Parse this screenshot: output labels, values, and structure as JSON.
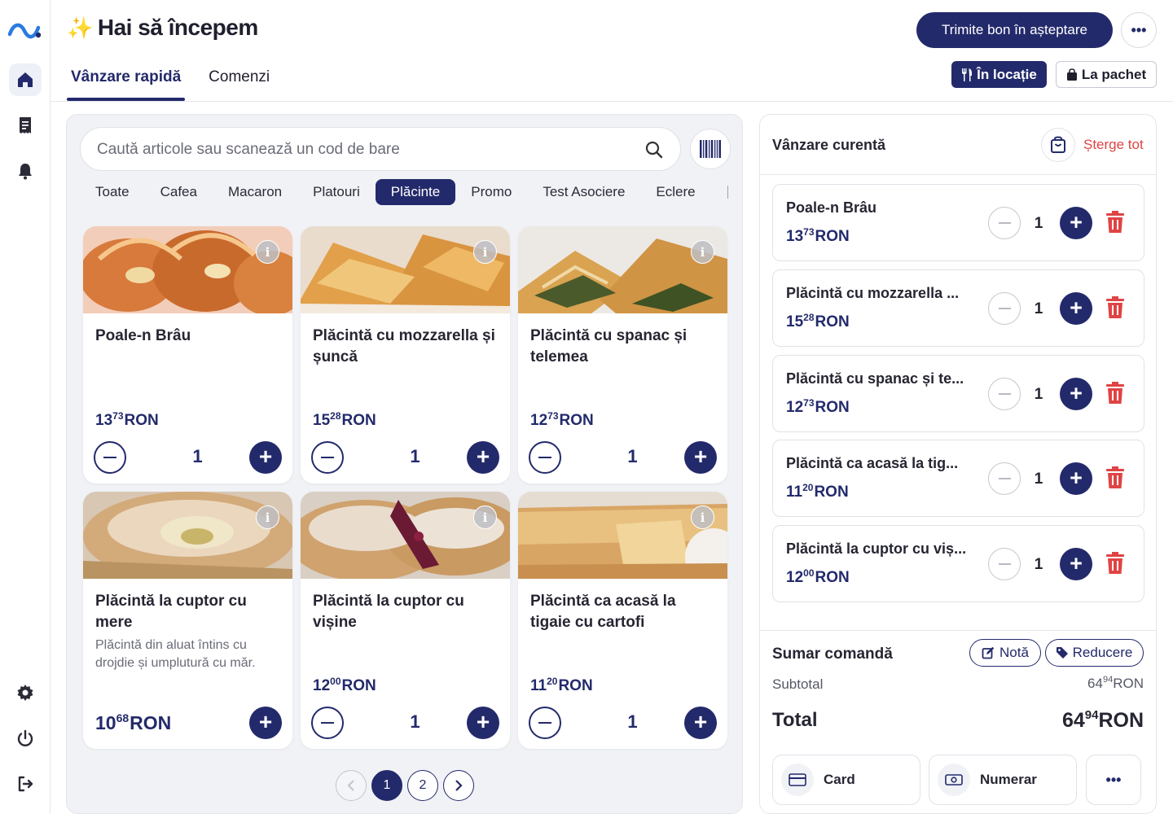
{
  "header": {
    "title": "Hai să începem",
    "tabs": [
      {
        "label": "Vânzare rapidă",
        "active": true
      },
      {
        "label": "Comenzi",
        "active": false
      }
    ],
    "send_button": "Trimite bon în așteptare",
    "more_button": "•••",
    "modes": {
      "dine_in": "În locație",
      "takeaway": "La pachet"
    }
  },
  "sidebar": {
    "items": [
      {
        "icon": "home-icon",
        "active": true
      },
      {
        "icon": "receipt-icon",
        "active": false
      },
      {
        "icon": "bell-icon",
        "active": false
      },
      {
        "icon": "gear-icon",
        "active": false
      },
      {
        "icon": "power-icon",
        "active": false
      },
      {
        "icon": "logout-icon",
        "active": false
      }
    ]
  },
  "catalog": {
    "search_placeholder": "Caută articole sau scanează un cod de bare",
    "categories": [
      "Toate",
      "Cafea",
      "Macaron",
      "Platouri",
      "Plăcinte",
      "Promo",
      "Test Asociere",
      "Eclere"
    ],
    "active_category": "Plăcinte",
    "products": [
      {
        "name": "Poale-n Brâu",
        "desc": "",
        "price_int": "13",
        "price_dec": "73",
        "currency": "RON",
        "qty": "1"
      },
      {
        "name": "Plăcintă cu mozzarella și șuncă",
        "desc": "",
        "price_int": "15",
        "price_dec": "28",
        "currency": "RON",
        "qty": "1"
      },
      {
        "name": "Plăcintă cu spanac și telemea",
        "desc": "",
        "price_int": "12",
        "price_dec": "73",
        "currency": "RON",
        "qty": "1"
      },
      {
        "name": "Plăcintă la cuptor cu mere",
        "desc": "Plăcintă din aluat întins cu drojdie și umplutură cu măr.",
        "price_int": "10",
        "price_dec": "68",
        "currency": "RON",
        "qty": ""
      },
      {
        "name": "Plăcintă la cuptor cu vișine",
        "desc": "",
        "price_int": "12",
        "price_dec": "00",
        "currency": "RON",
        "qty": "1"
      },
      {
        "name": "Plăcintă ca acasă la tigaie cu cartofi",
        "desc": "",
        "price_int": "11",
        "price_dec": "20",
        "currency": "RON",
        "qty": "1"
      }
    ],
    "pagination": {
      "pages": [
        "1",
        "2"
      ],
      "current": "1"
    }
  },
  "cart": {
    "title": "Vânzare curentă",
    "clear_label": "Șterge tot",
    "lines": [
      {
        "name": "Poale-n Brâu",
        "price_int": "13",
        "price_dec": "73",
        "currency": "RON",
        "qty": "1"
      },
      {
        "name": "Plăcintă cu mozzarella ...",
        "price_int": "15",
        "price_dec": "28",
        "currency": "RON",
        "qty": "1"
      },
      {
        "name": "Plăcintă cu spanac și te...",
        "price_int": "12",
        "price_dec": "73",
        "currency": "RON",
        "qty": "1"
      },
      {
        "name": "Plăcintă ca acasă la tig...",
        "price_int": "11",
        "price_dec": "20",
        "currency": "RON",
        "qty": "1"
      },
      {
        "name": "Plăcintă la cuptor cu viș...",
        "price_int": "12",
        "price_dec": "00",
        "currency": "RON",
        "qty": "1"
      }
    ],
    "summary": {
      "title": "Sumar comandă",
      "note_button": "Notă",
      "discount_button": "Reducere",
      "subtotal_label": "Subtotal",
      "subtotal_int": "64",
      "subtotal_dec": "94",
      "total_label": "Total",
      "total_int": "64",
      "total_dec": "94",
      "currency": "RON"
    },
    "payments": {
      "card": "Card",
      "cash": "Numerar",
      "more": "•••"
    }
  },
  "colors": {
    "primary": "#232a6b",
    "danger": "#e04343",
    "panel": "#f1f2f6",
    "sparkle": "#f3c33b"
  }
}
